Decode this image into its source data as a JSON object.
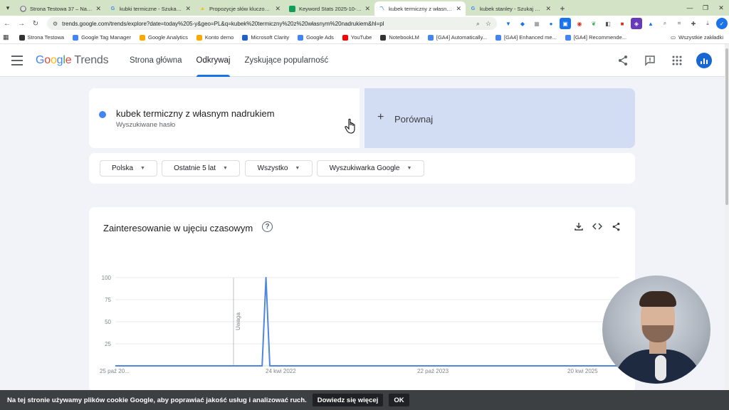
{
  "browser": {
    "tabs": [
      {
        "title": "Strona Testowa 37 – Na tej stro",
        "icon": "globe-icon",
        "active": false
      },
      {
        "title": "kubki termiczne - Szukaj w Goo",
        "icon": "google-icon",
        "active": false
      },
      {
        "title": "Propozycje słów kluczowych - K",
        "icon": "google-ads-icon",
        "active": false
      },
      {
        "title": "Keyword Stats 2025-10-30 at 0",
        "icon": "sheets-icon",
        "active": false
      },
      {
        "title": "kubek termiczny z własnym nad",
        "icon": "trends-icon",
        "active": true
      },
      {
        "title": "kubek stanley - Szukaj w Googl",
        "icon": "google-icon",
        "active": false
      }
    ],
    "url": "trends.google.com/trends/explore?date=today%205-y&geo=PL&q=kubek%20termiczny%20z%20własnym%20nadrukiem&hl=pl",
    "bookmarks": [
      {
        "label": "Strona Testowa",
        "color": "#333333"
      },
      {
        "label": "Google Tag Manager",
        "color": "#4285f4"
      },
      {
        "label": "Google Analytics",
        "color": "#f9ab00"
      },
      {
        "label": "Konto demo",
        "color": "#f9ab00"
      },
      {
        "label": "Microsoft Clarity",
        "color": "#1f62c7"
      },
      {
        "label": "Google Ads",
        "color": "#4285f4"
      },
      {
        "label": "YouTube",
        "color": "#ff0000"
      },
      {
        "label": "NotebookLM",
        "color": "#333333"
      },
      {
        "label": "[GA4] Automatically...",
        "color": "#4285f4"
      },
      {
        "label": "[GA4] Enhanced me...",
        "color": "#4285f4"
      },
      {
        "label": "[GA4] Recommende...",
        "color": "#4285f4"
      }
    ],
    "all_bookmarks": "Wszystkie zakładki"
  },
  "trends": {
    "logo_google": "Google",
    "logo_trends": "Trends",
    "nav": [
      "Strona główna",
      "Odkrywaj",
      "Zyskujące popularność"
    ],
    "active_nav": 1,
    "search_term": "kubek termiczny z własnym nadrukiem",
    "search_sub": "Wyszukiwane hasło",
    "compare_label": "Porównaj",
    "filters": [
      "Polska",
      "Ostatnie 5 lat",
      "Wszystko",
      "Wyszukiwarka Google"
    ],
    "chart_title": "Zainteresowanie w ujęciu czasowym"
  },
  "chart_data": {
    "type": "line",
    "title": "Zainteresowanie w ujęciu czasowym",
    "xlabel": "",
    "ylabel": "",
    "ylim": [
      0,
      100
    ],
    "yticks": [
      25,
      50,
      75,
      100
    ],
    "x_tick_labels": [
      "25 paź 20...",
      "24 kwi 2022",
      "22 paź 2023",
      "20 kwi 2025"
    ],
    "annotation": "Uwaga",
    "series": [
      {
        "color": "#4e86e0",
        "points": [
          {
            "x": "2020-10-25",
            "y": 0
          },
          {
            "x": "2022-04-10",
            "y": 0
          },
          {
            "x": "2022-04-17",
            "y": 50
          },
          {
            "x": "2022-04-24",
            "y": 100
          },
          {
            "x": "2022-05-01",
            "y": 50
          },
          {
            "x": "2022-05-08",
            "y": 0
          },
          {
            "x": "2025-10-26",
            "y": 0
          }
        ]
      }
    ],
    "grid": true,
    "legend": "none"
  },
  "cookie": {
    "text": "Na tej stronie używamy plików cookie Google, aby poprawiać jakość usług i analizować ruch.",
    "more": "Dowiedz się więcej",
    "ok": "OK"
  }
}
